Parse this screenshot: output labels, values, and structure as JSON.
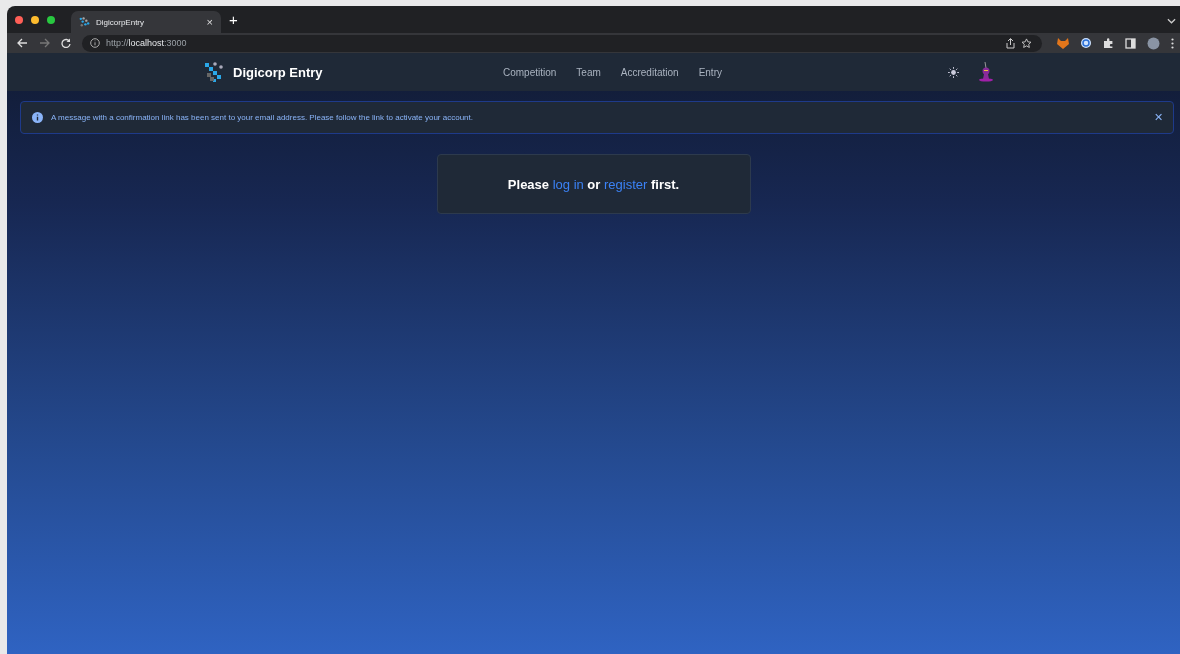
{
  "browser": {
    "tab": {
      "title": "DigicorpEntry",
      "close": "×"
    },
    "new_tab": "+",
    "url": {
      "scheme": "http://",
      "host": "localhost",
      "port": ":3000"
    }
  },
  "navbar": {
    "brand": "Digicorp Entry",
    "links": [
      {
        "label": "Competition"
      },
      {
        "label": "Team"
      },
      {
        "label": "Accreditation"
      },
      {
        "label": "Entry"
      }
    ]
  },
  "alert": {
    "message": "A message with a confirmation link has been sent to your email address. Please follow the link to activate your account.",
    "close": "✕"
  },
  "prompt": {
    "parts": [
      {
        "kind": "text",
        "text": "Please "
      },
      {
        "kind": "link",
        "text": "log in"
      },
      {
        "kind": "text",
        "text": " or "
      },
      {
        "kind": "link",
        "text": "register"
      },
      {
        "kind": "text",
        "text": " first."
      }
    ]
  }
}
